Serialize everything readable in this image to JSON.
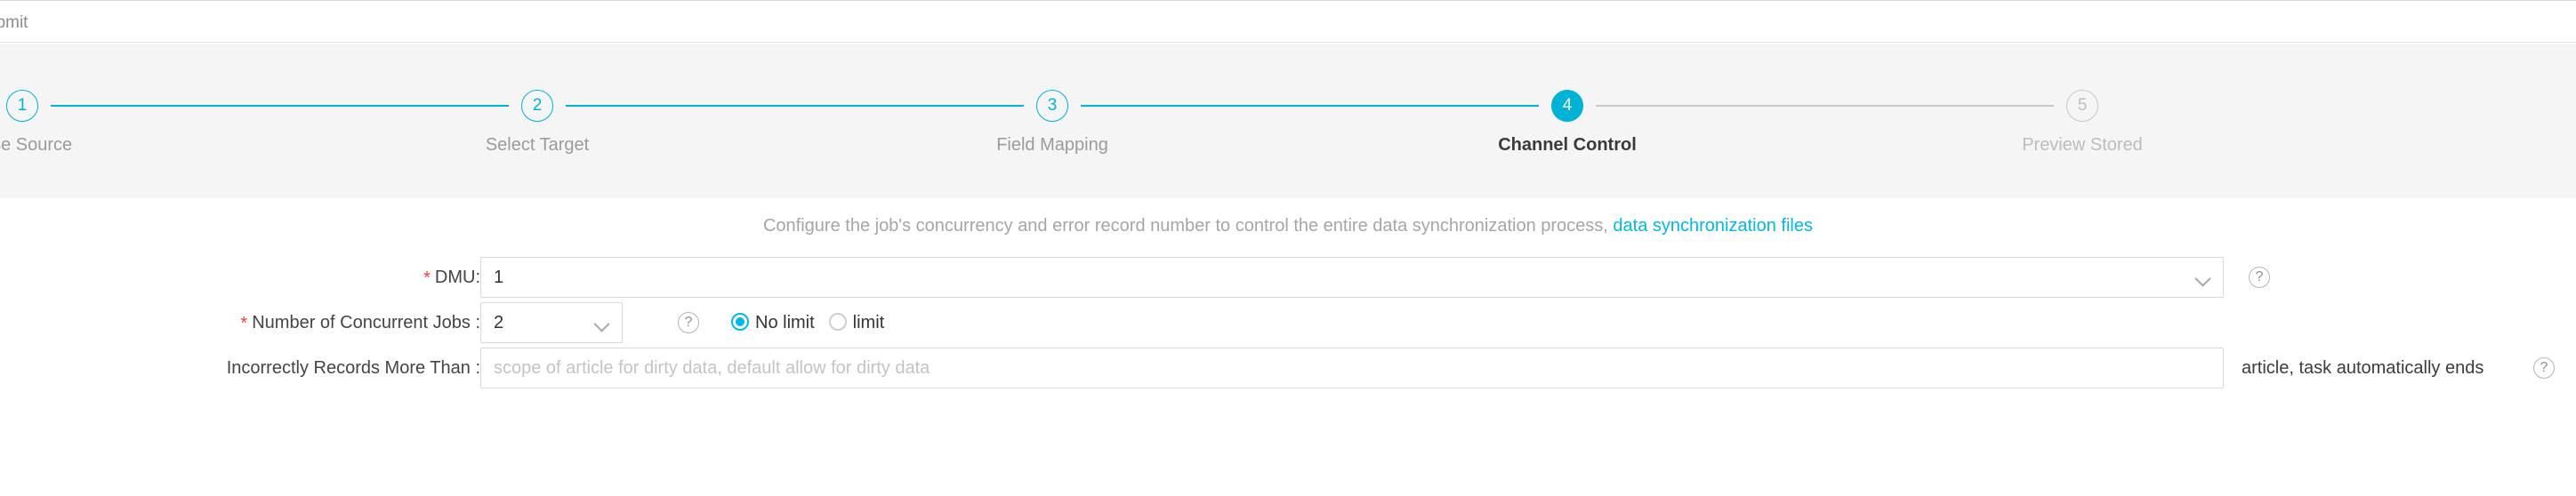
{
  "topbar": {
    "submit_label": "ubmit"
  },
  "stepper": {
    "steps": [
      {
        "number": "1",
        "label": "oose Source",
        "state": "done"
      },
      {
        "number": "2",
        "label": "Select Target",
        "state": "done"
      },
      {
        "number": "3",
        "label": "Field Mapping",
        "state": "done"
      },
      {
        "number": "4",
        "label": "Channel Control",
        "state": "active"
      },
      {
        "number": "5",
        "label": "Preview Stored",
        "state": "todo"
      }
    ],
    "colors": {
      "active": "#00b2d6",
      "done_line": "#00b2d6",
      "todo_line": "#c8c8c8",
      "panel_bg": "#f5f5f5"
    }
  },
  "form": {
    "hint_text": "Configure the job's concurrency and error record number to control the entire data synchronization process, ",
    "hint_link": "data synchronization files",
    "link_color": "#00b9e4",
    "dmu": {
      "label": "DMU:",
      "required": true,
      "value": "1",
      "dropdown_icon": "chevron-down-icon",
      "help_icon": "question-mark-icon"
    },
    "concurrent": {
      "label": "Number of Concurrent Jobs :",
      "required": true,
      "value": "2",
      "dropdown_icon": "chevron-down-icon",
      "help_icon": "question-mark-icon",
      "radios": [
        {
          "label": "No limit",
          "checked": true
        },
        {
          "label": "limit",
          "checked": false
        }
      ]
    },
    "dirty": {
      "label": "Incorrectly Records More Than :",
      "required": false,
      "value": "",
      "placeholder": "scope of article for dirty data, default allow for dirty data",
      "suffix": "article, task automatically ends",
      "help_icon": "question-mark-icon"
    }
  }
}
